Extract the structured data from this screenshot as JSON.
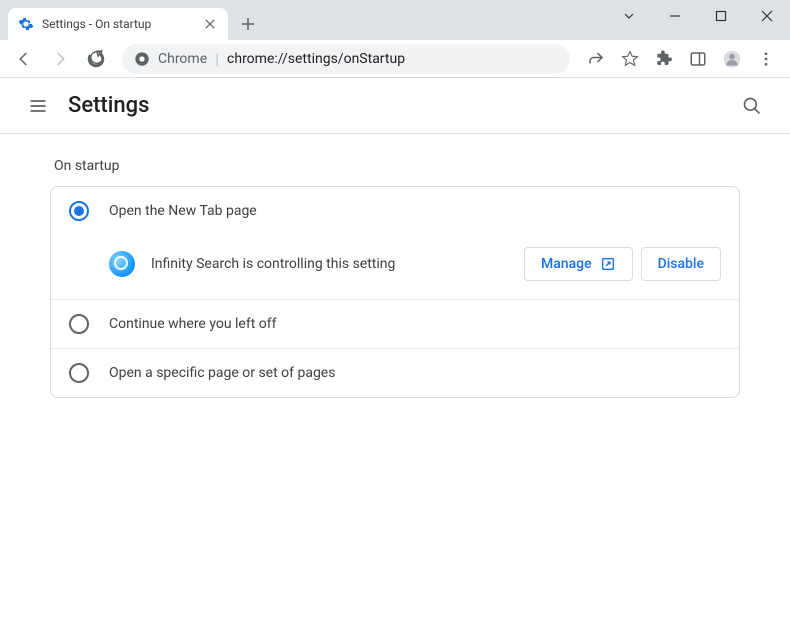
{
  "tab": {
    "title": "Settings - On startup"
  },
  "omnibox": {
    "scheme_label": "Chrome",
    "url": "chrome://settings/onStartup"
  },
  "header": {
    "title": "Settings"
  },
  "section": {
    "title": "On startup"
  },
  "options": {
    "open_new_tab": "Open the New Tab page",
    "continue": "Continue where you left off",
    "specific": "Open a specific page or set of pages"
  },
  "extension_notice": {
    "text": "Infinity Search is controlling this setting",
    "manage_label": "Manage",
    "disable_label": "Disable"
  }
}
